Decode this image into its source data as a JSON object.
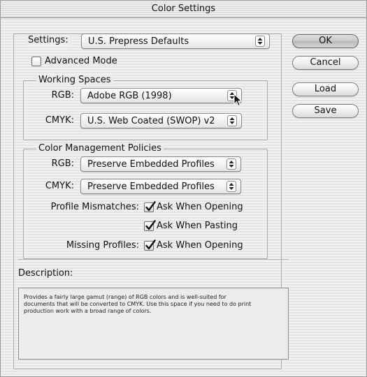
{
  "window": {
    "title": "Color Settings"
  },
  "settings": {
    "label": "Settings:",
    "value": "U.S. Prepress Defaults"
  },
  "advanced_mode": {
    "label": "Advanced Mode",
    "checked": false
  },
  "working_spaces": {
    "title": "Working Spaces",
    "rgb": {
      "label": "RGB:",
      "value": "Adobe RGB (1998)"
    },
    "cmyk": {
      "label": "CMYK:",
      "value": "U.S. Web Coated (SWOP) v2"
    }
  },
  "policies": {
    "title": "Color Management Policies",
    "rgb": {
      "label": "RGB:",
      "value": "Preserve Embedded Profiles"
    },
    "cmyk": {
      "label": "CMYK:",
      "value": "Preserve Embedded Profiles"
    },
    "profile_mismatches": {
      "label": "Profile Mismatches:",
      "ask_when_opening": {
        "label": "Ask When Opening",
        "checked": true
      },
      "ask_when_pasting": {
        "label": "Ask When Pasting",
        "checked": true
      }
    },
    "missing_profiles": {
      "label": "Missing Profiles:",
      "ask_when_opening": {
        "label": "Ask When Opening",
        "checked": true
      }
    }
  },
  "description": {
    "label": "Description:",
    "text": "Provides a fairly large gamut (range) of RGB colors and is well-suited for documents that will be converted to CMYK. Use this space if you need to do print production work with a broad range of colors."
  },
  "buttons": {
    "ok": "OK",
    "cancel": "Cancel",
    "load": "Load",
    "save": "Save"
  },
  "icons": {
    "popup": "up-down-arrows-icon",
    "checkmark": "checkmark-icon",
    "cursor": "arrow-cursor-icon"
  }
}
